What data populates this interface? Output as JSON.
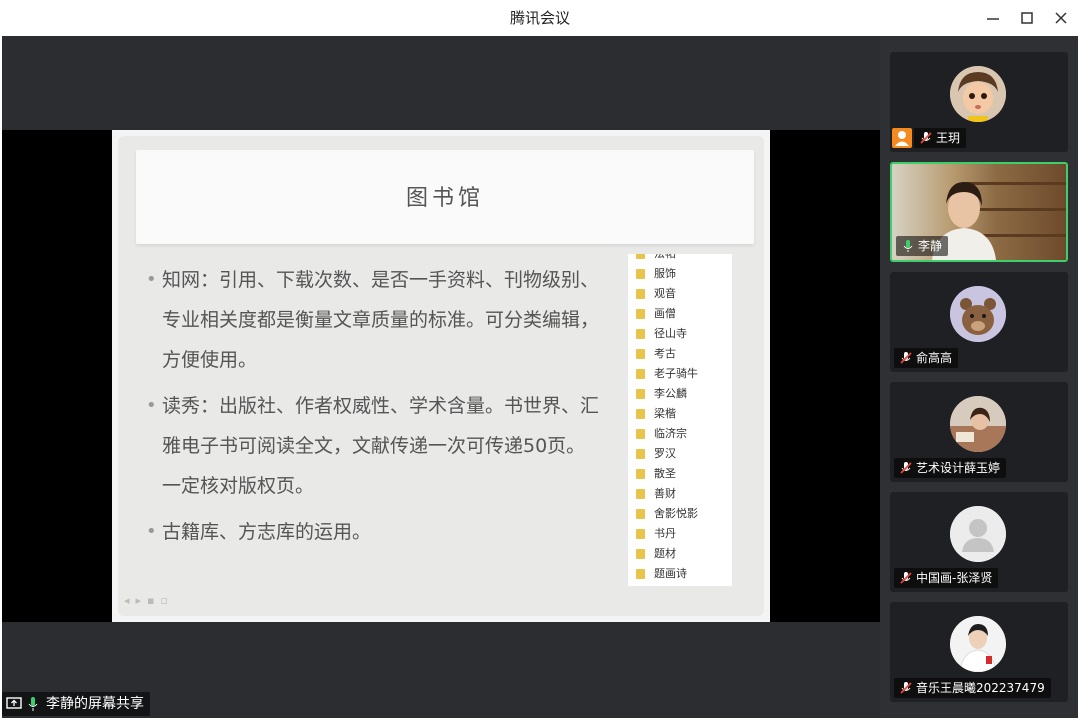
{
  "window": {
    "title": "腾讯会议"
  },
  "slide": {
    "title": "图书馆",
    "bullets": [
      "知网：引用、下载次数、是否一手资料、刊物级别、专业相关度都是衡量文章质量的标准。可分类编辑，方便使用。",
      "读秀：出版社、作者权威性、学术含量。书世界、汇雅电子书可阅读全文，文献传递一次可传递50页。一定核对版权页。",
      "古籍库、方志库的运用。"
    ],
    "folders": [
      "法帖",
      "服饰",
      "观音",
      "画僧",
      "径山寺",
      "考古",
      "老子骑牛",
      "李公麟",
      "梁楷",
      "临济宗",
      "罗汉",
      "散圣",
      "善财",
      "舍影悦影",
      "书丹",
      "题材",
      "题画诗"
    ]
  },
  "participants": [
    {
      "name": "王玥",
      "mic": "muted",
      "host": true,
      "avatar": "cartoon-girl-avatar"
    },
    {
      "name": "李静",
      "mic": "active",
      "host": false,
      "avatar": "video-feed"
    },
    {
      "name": "俞高高",
      "mic": "muted",
      "host": false,
      "avatar": "bear-avatar"
    },
    {
      "name": "艺术设计薛玉婷",
      "mic": "muted",
      "host": false,
      "avatar": "photo-avatar"
    },
    {
      "name": "中国画-张泽贤",
      "mic": "muted",
      "host": false,
      "avatar": "default-user-avatar"
    },
    {
      "name": "音乐王晨曦202237479",
      "mic": "muted",
      "host": false,
      "avatar": "photo-avatar"
    }
  ],
  "share": {
    "label": "李静的屏幕共享"
  },
  "colors": {
    "active_border": "#3ecf6a",
    "host_badge": "#f58a1f",
    "muted_red": "#e8453c"
  }
}
